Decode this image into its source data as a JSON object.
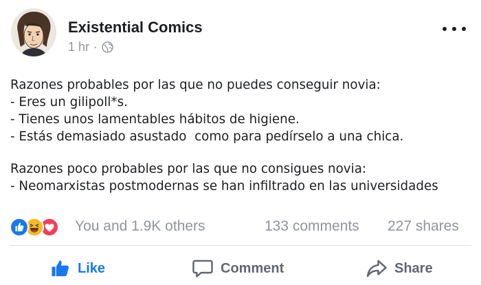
{
  "post": {
    "author": "Existential Comics",
    "time": "1 hr",
    "separator": "·",
    "privacy_icon": "globe-icon",
    "more_icon": "more-options-icon",
    "body_lines": [
      "Razones probables por las que no puedes conseguir novia:",
      "- Eres un gilipoll*s.",
      "- Tienes unos lamentables hábitos de higiene.",
      "- Estás demasiado asustado  como para pedírselo a una chica.",
      "",
      "Razones poco probables por las que no consigues novia:",
      "- Neomarxistas postmodernas se han infiltrado en las universidades"
    ]
  },
  "stats": {
    "reactions": [
      "like-reaction-icon",
      "haha-reaction-icon",
      "love-reaction-icon"
    ],
    "reaction_colors": {
      "like": "#1877f2",
      "haha": "#f7b928",
      "love": "#f33e58"
    },
    "likes_text": "You and 1.9K others",
    "comments_text": "133 comments",
    "shares_text": "227 shares"
  },
  "actions": {
    "like_label": "Like",
    "comment_label": "Comment",
    "share_label": "Share",
    "like_active_color": "#1877f2"
  }
}
